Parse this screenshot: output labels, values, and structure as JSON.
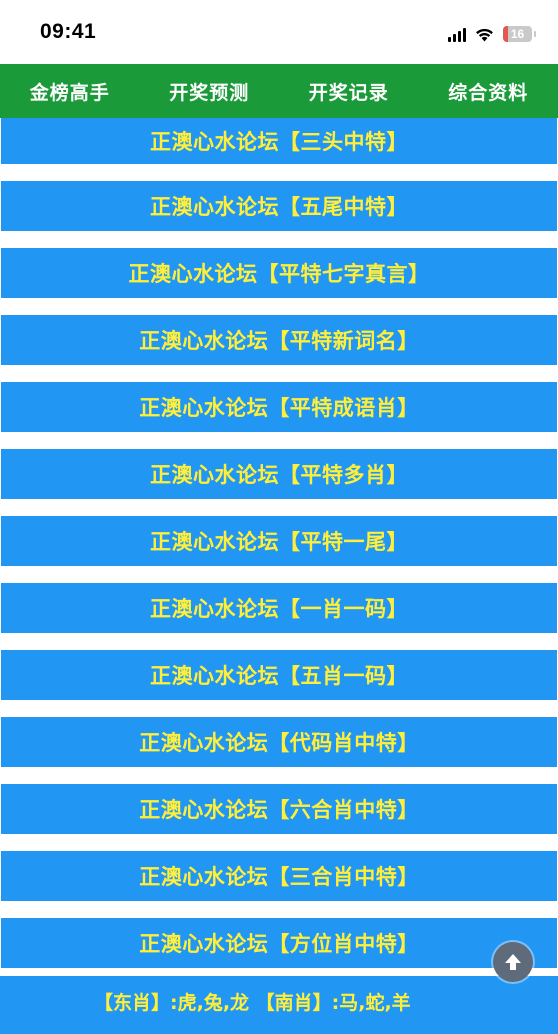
{
  "status": {
    "time": "09:41",
    "battery": "16"
  },
  "nav": [
    {
      "label": "金榜高手"
    },
    {
      "label": "开奖预测"
    },
    {
      "label": "开奖记录"
    },
    {
      "label": "综合资料"
    }
  ],
  "banners": [
    {
      "label": "正澳心水论坛【三头中特】"
    },
    {
      "label": "正澳心水论坛【五尾中特】"
    },
    {
      "label": "正澳心水论坛【平特七字真言】"
    },
    {
      "label": "正澳心水论坛【平特新词名】"
    },
    {
      "label": "正澳心水论坛【平特成语肖】"
    },
    {
      "label": "正澳心水论坛【平特多肖】"
    },
    {
      "label": "正澳心水论坛【平特一尾】"
    },
    {
      "label": "正澳心水论坛【一肖一码】"
    },
    {
      "label": "正澳心水论坛【五肖一码】"
    },
    {
      "label": "正澳心水论坛【代码肖中特】"
    },
    {
      "label": "正澳心水论坛【六合肖中特】"
    },
    {
      "label": "正澳心水论坛【三合肖中特】"
    },
    {
      "label": "正澳心水论坛【方位肖中特】"
    }
  ],
  "zodiac_info": {
    "line1": "【东肖】:虎,兔,龙 【南肖】:马,蛇,羊"
  },
  "colors": {
    "nav_bg": "#1b9a3a",
    "banner_bg": "#2196f3",
    "banner_text": "#ffef3a"
  }
}
